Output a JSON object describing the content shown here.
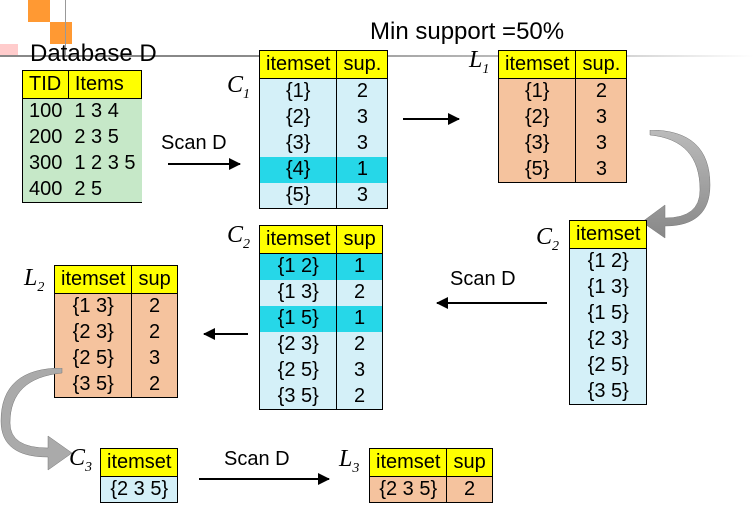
{
  "title_min": "Min support =50%",
  "labels": {
    "database": "Database D",
    "scan": "Scan D",
    "C1": "C",
    "C1s": "1",
    "L1": "L",
    "L1s": "1",
    "C2": "C",
    "C2s": "2",
    "L2": "L",
    "L2s": "2",
    "C3": "C",
    "C3s": "3",
    "L3": "L",
    "L3s": "3"
  },
  "headers": {
    "tid": "TID",
    "items": "Items",
    "itemset": "itemset",
    "sup": "sup.",
    "supNoDot": "sup"
  },
  "D": [
    {
      "tid": "100",
      "items": "1 3 4"
    },
    {
      "tid": "200",
      "items": "2 3 5"
    },
    {
      "tid": "300",
      "items": "1 2 3 5"
    },
    {
      "tid": "400",
      "items": "2 5"
    }
  ],
  "C1": [
    {
      "itemset": "{1}",
      "sup": "2",
      "hl": false
    },
    {
      "itemset": "{2}",
      "sup": "3",
      "hl": false
    },
    {
      "itemset": "{3}",
      "sup": "3",
      "hl": false
    },
    {
      "itemset": "{4}",
      "sup": "1",
      "hl": true
    },
    {
      "itemset": "{5}",
      "sup": "3",
      "hl": false
    }
  ],
  "L1": [
    {
      "itemset": "{1}",
      "sup": "2"
    },
    {
      "itemset": "{2}",
      "sup": "3"
    },
    {
      "itemset": "{3}",
      "sup": "3"
    },
    {
      "itemset": "{5}",
      "sup": "3"
    }
  ],
  "C2set": [
    {
      "itemset": "{1 2}"
    },
    {
      "itemset": "{1 3}"
    },
    {
      "itemset": "{1 5}"
    },
    {
      "itemset": "{2 3}"
    },
    {
      "itemset": "{2 5}"
    },
    {
      "itemset": "{3 5}"
    }
  ],
  "C2": [
    {
      "itemset": "{1 2}",
      "sup": "1",
      "hl": true
    },
    {
      "itemset": "{1 3}",
      "sup": "2",
      "hl": false
    },
    {
      "itemset": "{1 5}",
      "sup": "1",
      "hl": true
    },
    {
      "itemset": "{2 3}",
      "sup": "2",
      "hl": false
    },
    {
      "itemset": "{2 5}",
      "sup": "3",
      "hl": false
    },
    {
      "itemset": "{3 5}",
      "sup": "2",
      "hl": false
    }
  ],
  "L2": [
    {
      "itemset": "{1 3}",
      "sup": "2"
    },
    {
      "itemset": "{2 3}",
      "sup": "2"
    },
    {
      "itemset": "{2 5}",
      "sup": "3"
    },
    {
      "itemset": "{3 5}",
      "sup": "2"
    }
  ],
  "C3": [
    {
      "itemset": "{2 3 5}"
    }
  ],
  "L3": [
    {
      "itemset": "{2 3 5}",
      "sup": "2"
    }
  ]
}
